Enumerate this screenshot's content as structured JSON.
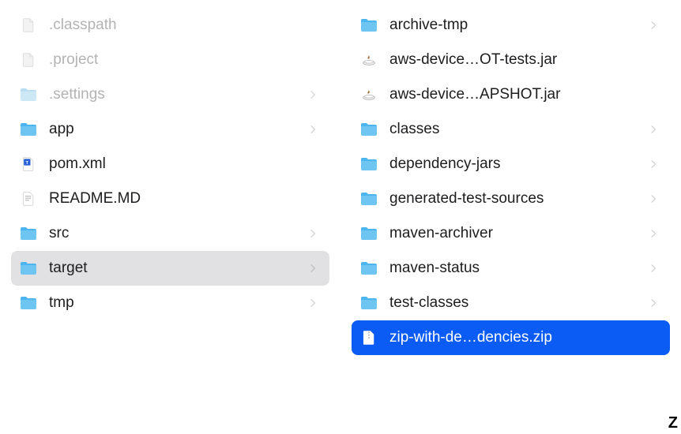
{
  "leftColumn": [
    {
      "name": ".classpath",
      "icon": "file-faded",
      "faded": true,
      "hasChildren": false,
      "active": false,
      "selected": false
    },
    {
      "name": ".project",
      "icon": "file-faded",
      "faded": true,
      "hasChildren": false,
      "active": false,
      "selected": false
    },
    {
      "name": ".settings",
      "icon": "folder-faded",
      "faded": true,
      "hasChildren": true,
      "active": false,
      "selected": false
    },
    {
      "name": "app",
      "icon": "folder",
      "faded": false,
      "hasChildren": true,
      "active": false,
      "selected": false
    },
    {
      "name": "pom.xml",
      "icon": "xml-file",
      "faded": false,
      "hasChildren": false,
      "active": false,
      "selected": false
    },
    {
      "name": "README.MD",
      "icon": "text-file",
      "faded": false,
      "hasChildren": false,
      "active": false,
      "selected": false
    },
    {
      "name": "src",
      "icon": "folder",
      "faded": false,
      "hasChildren": true,
      "active": false,
      "selected": false
    },
    {
      "name": "target",
      "icon": "folder",
      "faded": false,
      "hasChildren": true,
      "active": true,
      "selected": false
    },
    {
      "name": "tmp",
      "icon": "folder",
      "faded": false,
      "hasChildren": true,
      "active": false,
      "selected": false
    }
  ],
  "rightColumn": [
    {
      "name": "archive-tmp",
      "icon": "folder",
      "hasChildren": true,
      "selected": false
    },
    {
      "name": "aws-device…OT-tests.jar",
      "icon": "jar-file",
      "hasChildren": false,
      "selected": false
    },
    {
      "name": "aws-device…APSHOT.jar",
      "icon": "jar-file",
      "hasChildren": false,
      "selected": false
    },
    {
      "name": "classes",
      "icon": "folder",
      "hasChildren": true,
      "selected": false
    },
    {
      "name": "dependency-jars",
      "icon": "folder",
      "hasChildren": true,
      "selected": false
    },
    {
      "name": "generated-test-sources",
      "icon": "folder",
      "hasChildren": true,
      "selected": false
    },
    {
      "name": "maven-archiver",
      "icon": "folder",
      "hasChildren": true,
      "selected": false
    },
    {
      "name": "maven-status",
      "icon": "folder",
      "hasChildren": true,
      "selected": false
    },
    {
      "name": "test-classes",
      "icon": "folder",
      "hasChildren": true,
      "selected": false
    },
    {
      "name": "zip-with-de…dencies.zip",
      "icon": "zip-file",
      "hasChildren": false,
      "selected": true
    }
  ],
  "cornerLetter": "Z"
}
